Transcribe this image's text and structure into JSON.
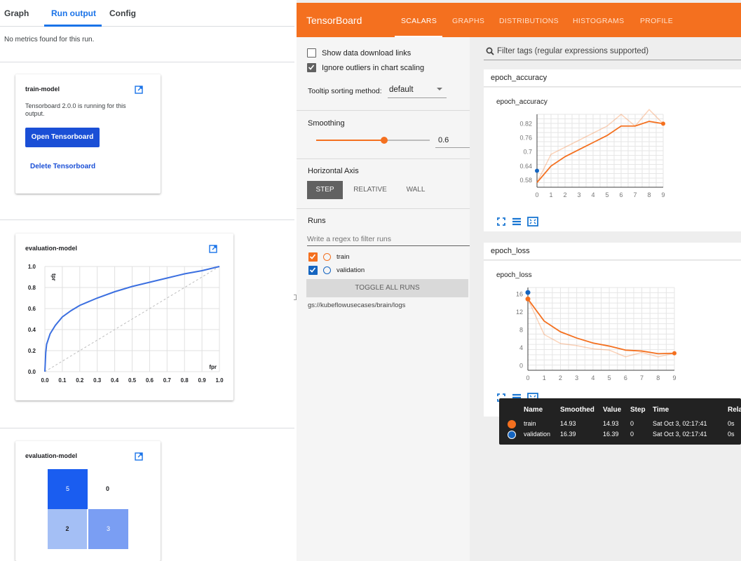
{
  "kubeflow": {
    "tabs": [
      "Graph",
      "Run output",
      "Config"
    ],
    "active_tab": "Run output",
    "no_metrics": "No metrics found for this run.",
    "card1": {
      "title": "train-model",
      "description": "Tensorboard 2.0.0 is running for this output.",
      "open_button": "Open Tensorboard",
      "delete_link": "Delete Tensorboard"
    },
    "card2": {
      "title": "evaluation-model",
      "y_axis_label": "tpr",
      "x_axis_label": "fpr"
    },
    "card3": {
      "title": "evaluation-model",
      "cells": [
        "5",
        "0",
        "2",
        "3"
      ]
    }
  },
  "roc_chart_data": {
    "type": "line",
    "title": "evaluation-model",
    "xlabel": "fpr",
    "ylabel": "tpr",
    "xlim": [
      0,
      1
    ],
    "ylim": [
      0,
      1
    ],
    "x_ticks": [
      "0.0",
      "0.1",
      "0.2",
      "0.3",
      "0.4",
      "0.5",
      "0.6",
      "0.7",
      "0.8",
      "0.9",
      "1.0"
    ],
    "y_ticks": [
      "0.0",
      "0.2",
      "0.4",
      "0.6",
      "0.8",
      "1.0"
    ],
    "series": [
      {
        "x": [
          0,
          0.005,
          0.01,
          0.03,
          0.06,
          0.1,
          0.15,
          0.2,
          0.3,
          0.4,
          0.5,
          0.6,
          0.7,
          0.8,
          0.9,
          1.0
        ],
        "y": [
          0,
          0.18,
          0.26,
          0.36,
          0.44,
          0.52,
          0.58,
          0.63,
          0.7,
          0.76,
          0.81,
          0.85,
          0.89,
          0.93,
          0.96,
          1.0
        ]
      },
      {
        "x": [
          0,
          1
        ],
        "y": [
          0,
          1
        ]
      }
    ],
    "grid": true
  },
  "tensorboard": {
    "brand": "TensorBoard",
    "nav": [
      "SCALARS",
      "GRAPHS",
      "DISTRIBUTIONS",
      "HISTOGRAMS",
      "PROFILE"
    ],
    "active_nav": "SCALARS",
    "show_download": "Show data download links",
    "ignore_outliers": "Ignore outliers in chart scaling",
    "tooltip_label": "Tooltip sorting method:",
    "tooltip_value": "default",
    "smoothing_label": "Smoothing",
    "smoothing_value": "0.6",
    "smoothing_level": 0.6,
    "horizontal_axis_label": "Horizontal Axis",
    "axis_options": [
      "STEP",
      "RELATIVE",
      "WALL"
    ],
    "axis_selected": "STEP",
    "runs_label": "Runs",
    "runs_filter_placeholder": "Write a regex to filter runs",
    "runs": [
      {
        "name": "train",
        "color": "#f4701f",
        "checked": true
      },
      {
        "name": "validation",
        "color": "#1565c0",
        "checked": true
      }
    ],
    "toggle_all": "TOGGLE ALL RUNS",
    "logdir": "gs://kubeflowusecases/brain/logs",
    "filter_placeholder": "Filter tags (regular expressions supported)",
    "section1": "epoch_accuracy",
    "section2": "epoch_loss",
    "chart1_title": "epoch_accuracy",
    "chart2_title": "epoch_loss",
    "tooltip": {
      "headers": [
        "Name",
        "Smoothed",
        "Value",
        "Step",
        "Time",
        "Relativ"
      ],
      "rows": [
        {
          "name": "train",
          "smoothed": "14.93",
          "value": "14.93",
          "step": "0",
          "time": "Sat Oct 3, 02:17:41",
          "relative": "0s",
          "color": "#f4701f"
        },
        {
          "name": "validation",
          "smoothed": "16.39",
          "value": "16.39",
          "step": "0",
          "time": "Sat Oct 3, 02:17:41",
          "relative": "0s",
          "color": "#1565c0"
        }
      ]
    }
  },
  "chart_data": [
    {
      "type": "line",
      "title": "epoch_accuracy",
      "x": [
        0,
        1,
        2,
        3,
        4,
        5,
        6,
        7,
        8,
        9
      ],
      "x_ticks": [
        "0",
        "1",
        "2",
        "3",
        "4",
        "5",
        "6",
        "7",
        "8",
        "9"
      ],
      "y_ticks": [
        "0.58",
        "0.64",
        "0.7",
        "0.76",
        "0.82"
      ],
      "ylim": [
        0.55,
        0.86
      ],
      "series": [
        {
          "name": "train",
          "smoothed": [
            0.57,
            0.64,
            0.68,
            0.71,
            0.74,
            0.77,
            0.81,
            0.81,
            0.83,
            0.82
          ],
          "raw": [
            0.57,
            0.69,
            0.72,
            0.75,
            0.78,
            0.81,
            0.86,
            0.81,
            0.88,
            0.82
          ],
          "color": "#f4701f"
        },
        {
          "name": "validation",
          "smoothed": [
            0.62
          ],
          "raw": [
            0.62
          ],
          "color": "#1565c0"
        }
      ],
      "grid": true
    },
    {
      "type": "line",
      "title": "epoch_loss",
      "x": [
        0,
        1,
        2,
        3,
        4,
        5,
        6,
        7,
        8,
        9
      ],
      "x_ticks": [
        "0",
        "1",
        "2",
        "3",
        "4",
        "5",
        "6",
        "7",
        "8",
        "9"
      ],
      "y_ticks": [
        "0",
        "4",
        "8",
        "12",
        "16"
      ],
      "ylim": [
        -1,
        17.5
      ],
      "series": [
        {
          "name": "train",
          "smoothed": [
            14.93,
            10.0,
            7.6,
            6.2,
            5.1,
            4.4,
            3.5,
            3.3,
            2.7,
            2.8
          ],
          "raw": [
            14.93,
            7.0,
            5.0,
            4.5,
            3.8,
            3.5,
            2.0,
            3.0,
            2.0,
            2.8
          ],
          "color": "#f4701f"
        },
        {
          "name": "validation",
          "smoothed": [
            16.39
          ],
          "raw": [
            16.39
          ],
          "color": "#1565c0"
        }
      ],
      "grid": true
    }
  ]
}
